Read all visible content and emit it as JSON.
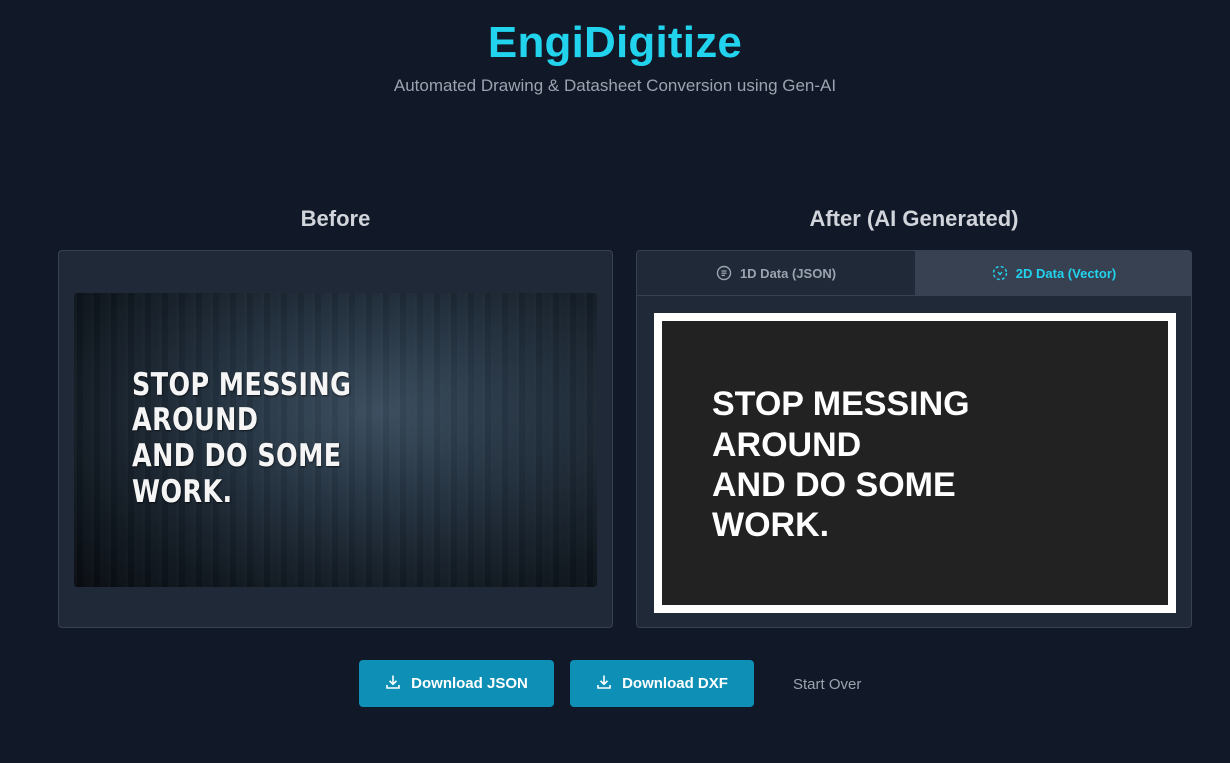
{
  "header": {
    "title": "EngiDigitize",
    "subtitle": "Automated Drawing & Datasheet Conversion using Gen-AI"
  },
  "before": {
    "heading": "Before",
    "image_text_lines": [
      "STOP MESSING",
      "AROUND",
      "AND DO SOME",
      "WORK."
    ]
  },
  "after": {
    "heading": "After (AI Generated)",
    "tabs": [
      {
        "label": "1D Data (JSON)",
        "icon": "json-doc-icon",
        "active": false
      },
      {
        "label": "2D Data (Vector)",
        "icon": "vector-scan-icon",
        "active": true
      }
    ],
    "vector_text_lines": [
      "STOP MESSING",
      "AROUND",
      "AND DO SOME",
      "WORK."
    ]
  },
  "actions": {
    "download_json": "Download JSON",
    "download_dxf": "Download DXF",
    "start_over": "Start Over"
  },
  "colors": {
    "background": "#111827",
    "accent": "#22d3ee",
    "button": "#0e8fb5",
    "panel": "#1f2937"
  }
}
